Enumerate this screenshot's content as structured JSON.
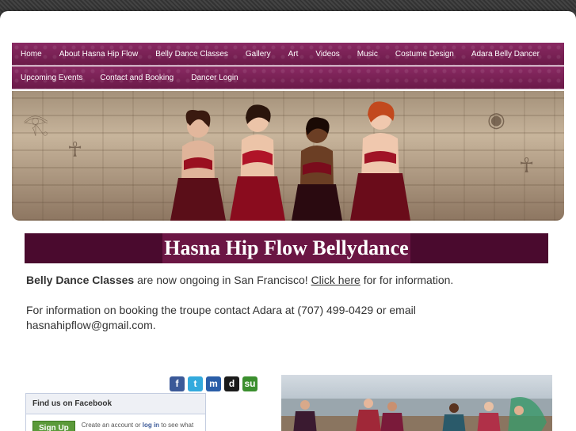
{
  "nav": {
    "row1": [
      "Home",
      "About Hasna Hip Flow",
      "Belly Dance Classes",
      "Gallery",
      "Art",
      "Videos",
      "Music",
      "Costume Design",
      "Adara Belly Dancer"
    ],
    "row2": [
      "Upcoming Events",
      "Contact and Booking",
      "Dancer Login"
    ]
  },
  "main": {
    "title": "Hasna Hip Flow Bellydance",
    "p1_bold": "Belly Dance Classes",
    "p1_mid": " are now ongoing in San Francisco! ",
    "p1_link": "Click here",
    "p1_end": " for for information.",
    "p2_line1": "For information on booking the troupe contact Adara at (707) 499-0429 or email",
    "p2_line2": "hasnahipflow@gmail.com."
  },
  "share": {
    "icons": [
      {
        "name": "facebook-share-icon",
        "glyph": "f",
        "color": "#3b5998"
      },
      {
        "name": "twitter-share-icon",
        "glyph": "t",
        "color": "#33aadd"
      },
      {
        "name": "myspace-share-icon",
        "glyph": "m",
        "color": "#2a5ea8"
      },
      {
        "name": "delicious-share-icon",
        "glyph": "d",
        "color": "#1a1a1a"
      },
      {
        "name": "stumbleupon-share-icon",
        "glyph": "su",
        "color": "#3b8f2e"
      }
    ]
  },
  "facebook": {
    "title": "Find us on Facebook",
    "signup": "Sign Up",
    "msg_start": "Create an account or ",
    "msg_link": "log in",
    "msg_end": " to see what"
  },
  "colors": {
    "nav": "#7a1f55",
    "title_bg": "#4a0a2e",
    "title_highlight": "#6b1644"
  }
}
